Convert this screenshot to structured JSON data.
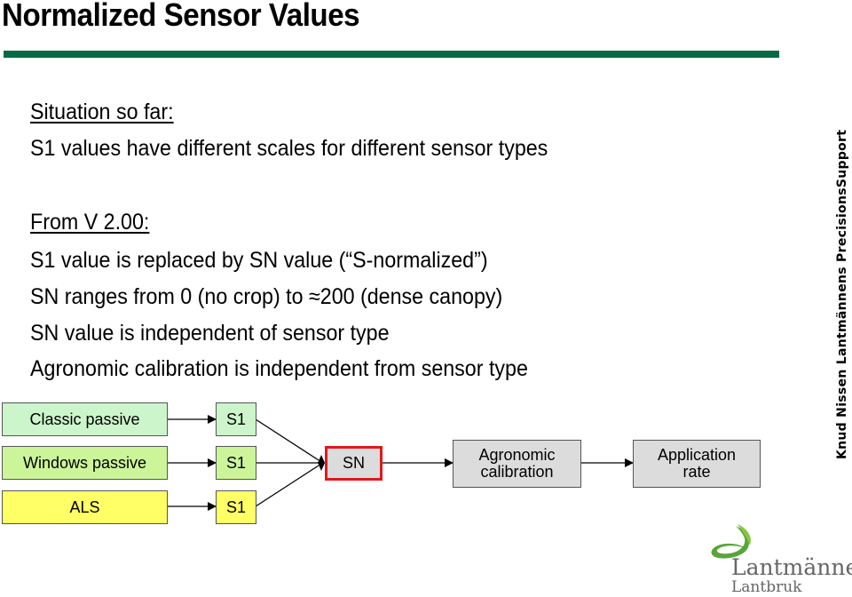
{
  "slide": {
    "title": "Normalized Sensor Values",
    "accent_color": "#046a45",
    "section1": {
      "heading": "Situation so far:",
      "lines": [
        "S1 values have different scales for different sensor types"
      ]
    },
    "section2": {
      "heading": "From V 2.00:",
      "lines": [
        "S1 value is replaced by SN value (“S-normalized”)",
        "SN ranges from 0 (no crop) to ≈200 (dense canopy)",
        "SN value is independent of sensor type",
        "Agronomic calibration is independent from sensor type"
      ]
    }
  },
  "diagram": {
    "sensors": [
      {
        "label": "Classic passive",
        "output": "S1",
        "color": "#ccf5cc"
      },
      {
        "label": "Windows passive",
        "output": "S1",
        "color": "#ccf599"
      },
      {
        "label": "ALS",
        "output": "S1",
        "color": "#ffff66"
      }
    ],
    "normalized": {
      "label": "SN",
      "border_color": "#e0181e"
    },
    "calibration": {
      "label_line1": "Agronomic",
      "label_line2": "calibration"
    },
    "result": {
      "label_line1": "Application",
      "label_line2": "rate"
    }
  },
  "sidebar_text": "Knud Nissen Lantmännens PrecisionsSupport",
  "logo": {
    "name": "Lantmännen",
    "sub": "Lantbruk"
  }
}
